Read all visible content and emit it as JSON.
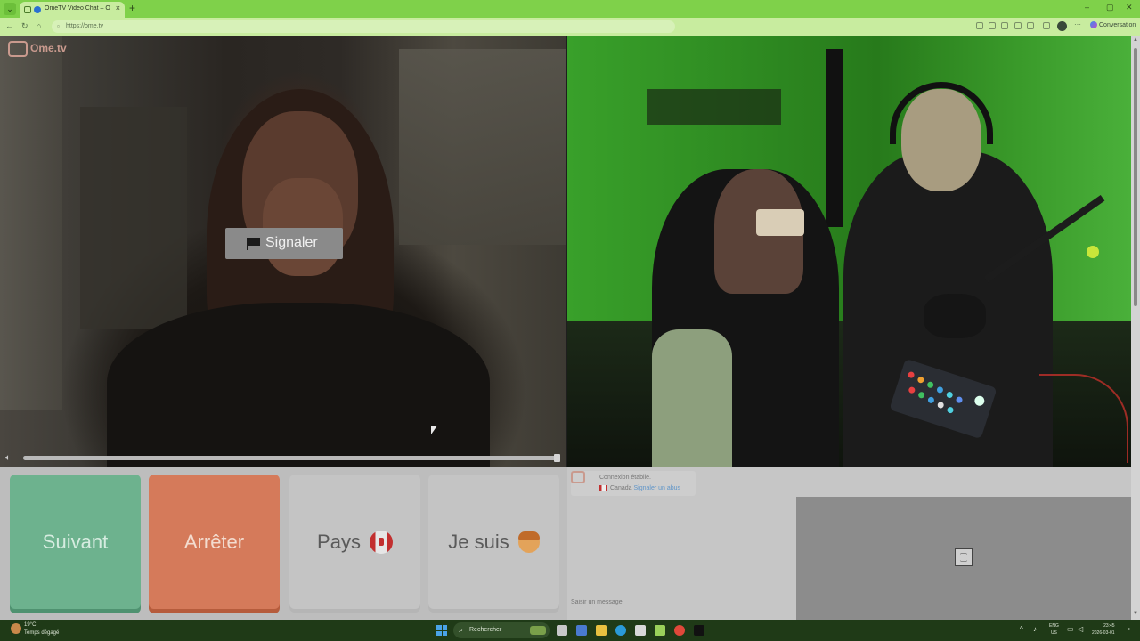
{
  "browser": {
    "tab_title": "OmeTV Video Chat – Omeg",
    "tab_close": "×",
    "new_tab": "+",
    "url": "https://ome.tv",
    "copilot_label": "Conversation",
    "window_controls": {
      "minimize": "–",
      "maximize": "▢",
      "close": "✕"
    }
  },
  "page": {
    "brand": "Ome.tv",
    "report_label": "Signaler",
    "volume_level": 1.0
  },
  "controls": {
    "next_label": "Suivant",
    "stop_label": "Arrêter",
    "country_label": "Pays",
    "gender_label": "Je suis"
  },
  "chat": {
    "status": "Connexion établie.",
    "country": "Canada",
    "report_link": "Signaler un abus",
    "input_placeholder": "Saisir un message"
  },
  "taskbar": {
    "weather_temp": "19°C",
    "weather_desc": "Temps dégagé",
    "search_label": "Rechercher",
    "lang_line1": "ENG",
    "lang_line2": "US",
    "time": "23:45",
    "date": "2026-03-01"
  },
  "colors": {
    "browser_accent": "#7fd14a",
    "next_button": "#6db28e",
    "stop_button": "#d57a5a"
  }
}
